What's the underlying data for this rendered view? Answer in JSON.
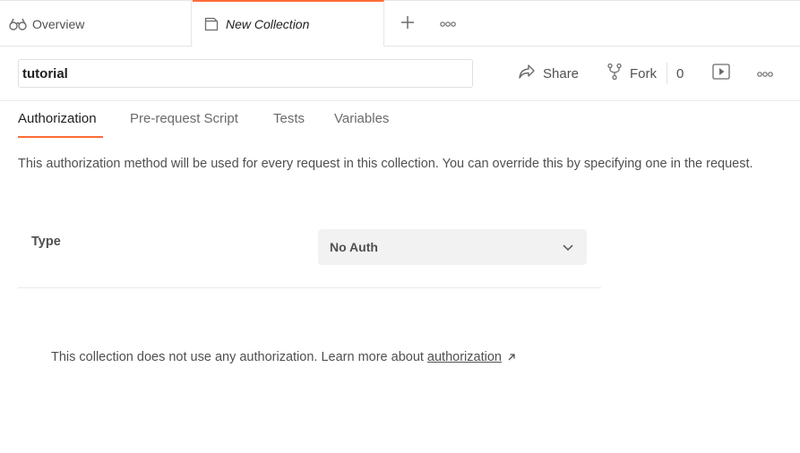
{
  "tabs": [
    {
      "label": "Overview",
      "icon": "overview-icon"
    },
    {
      "label": "New Collection",
      "icon": "collection-icon",
      "active": true
    }
  ],
  "header": {
    "collection_name": "tutorial",
    "share_label": "Share",
    "fork_label": "Fork",
    "fork_count": "0"
  },
  "subtabs": [
    {
      "label": "Authorization",
      "active": true
    },
    {
      "label": "Pre-request Script"
    },
    {
      "label": "Tests"
    },
    {
      "label": "Variables"
    }
  ],
  "auth": {
    "description": "This authorization method will be used for every request in this collection. You can override this by specifying one in the request.",
    "type_label": "Type",
    "type_value": "No Auth",
    "info_text": "This collection does not use any authorization. Learn more about",
    "info_link": "authorization"
  },
  "colors": {
    "accent": "#ff6c37",
    "text": "#212121",
    "muted": "#505050",
    "select_bg": "#f2f2f2"
  }
}
